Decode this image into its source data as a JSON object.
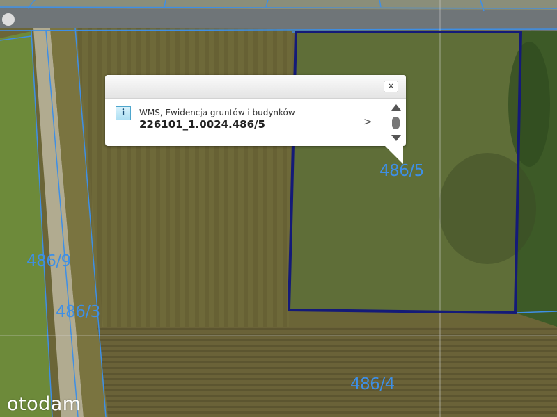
{
  "map": {
    "parcel_labels": [
      {
        "id": "parcel-486-5",
        "text": "486/5"
      },
      {
        "id": "parcel-486-9",
        "text": "486/9"
      },
      {
        "id": "parcel-486-3",
        "text": "486/3"
      },
      {
        "id": "parcel-486-4",
        "text": "486/4"
      }
    ],
    "colors": {
      "parcel_boundary": "#3e8fe6",
      "selected_parcel": "#141a78"
    }
  },
  "popup": {
    "info_icon_glyph": "i",
    "layer_name": "WMS, Ewidencja gruntów i budynków",
    "parcel_id": "226101_1.0024.486/5",
    "next_glyph": ">",
    "close_glyph": "✕"
  },
  "watermark": "otodam"
}
